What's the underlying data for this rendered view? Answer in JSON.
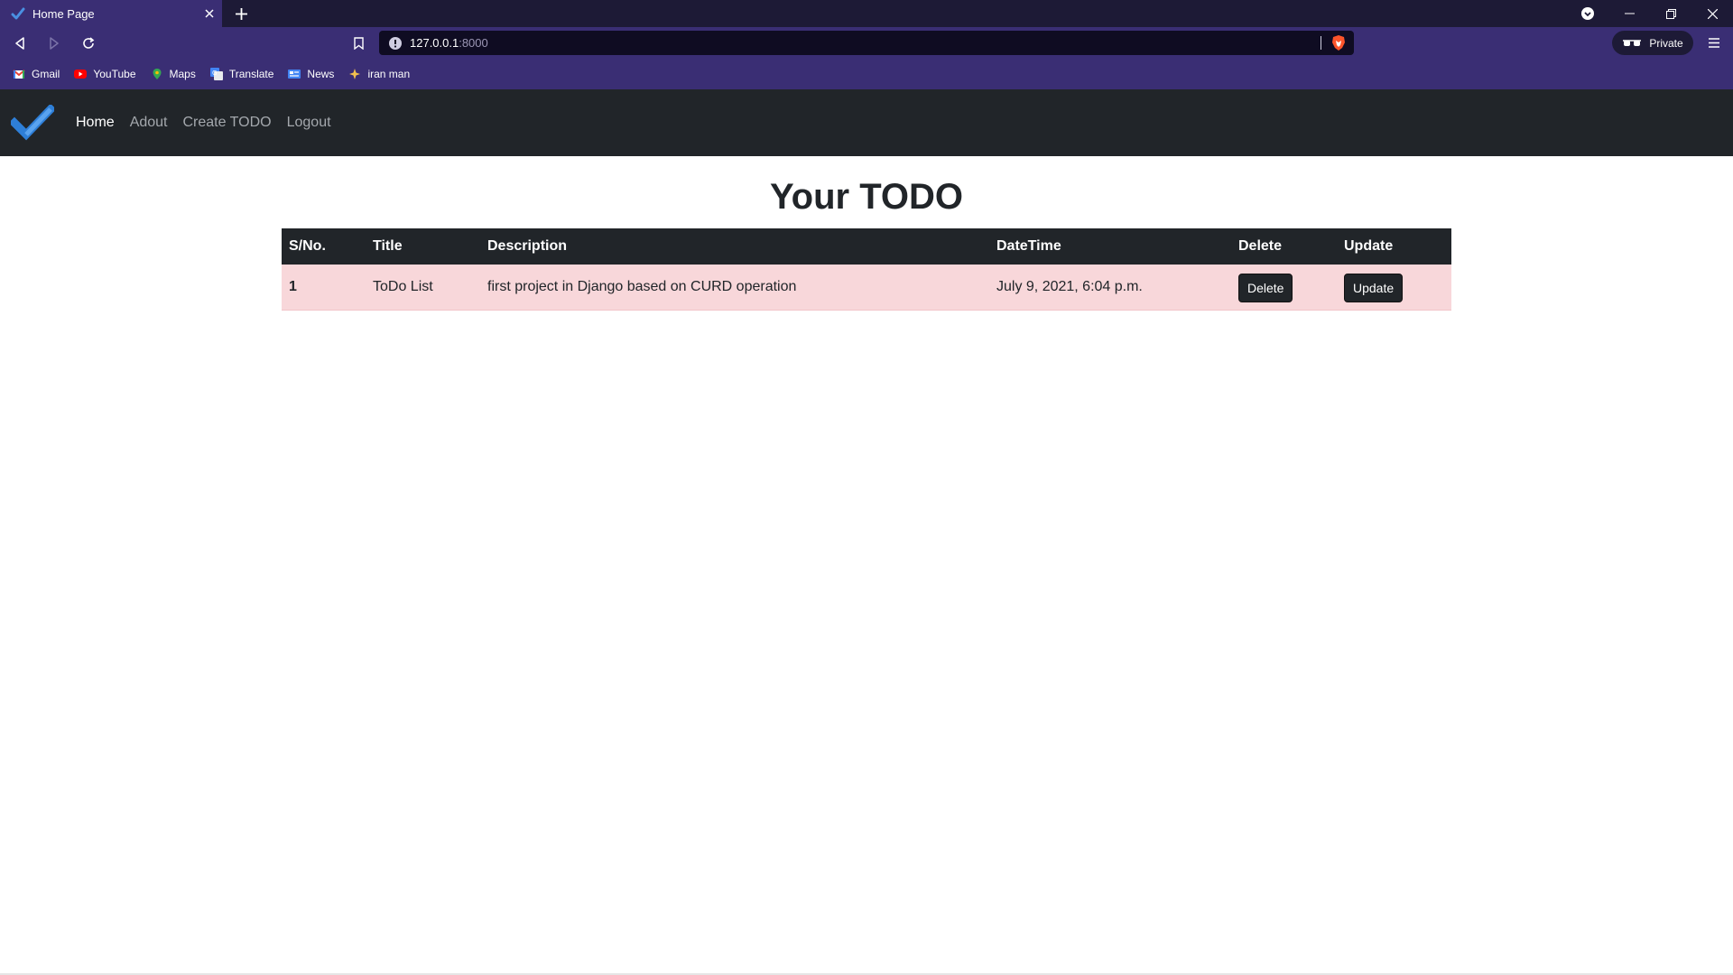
{
  "browser": {
    "tab_title": "Home Page",
    "url_host": "127.0.0.1",
    "url_port": ":8000",
    "private_label": "Private",
    "bookmarks": [
      {
        "label": "Gmail",
        "icon": "gmail-icon"
      },
      {
        "label": "YouTube",
        "icon": "youtube-icon"
      },
      {
        "label": "Maps",
        "icon": "maps-icon"
      },
      {
        "label": "Translate",
        "icon": "translate-icon"
      },
      {
        "label": "News",
        "icon": "news-icon"
      },
      {
        "label": "iran man",
        "icon": "bookmark-favicon-icon"
      }
    ]
  },
  "nav": {
    "links": [
      "Home",
      "Adout",
      "Create TODO",
      "Logout"
    ],
    "active": "Home"
  },
  "page": {
    "title": "Your TODO"
  },
  "table": {
    "headers": [
      "S/No.",
      "Title",
      "Description",
      "DateTime",
      "Delete",
      "Update"
    ],
    "rows": [
      {
        "sn": "1",
        "title": "ToDo List",
        "description": "first project in Django based on CURD operation",
        "datetime": "July 9, 2021, 6:04 p.m.",
        "delete_label": "Delete",
        "update_label": "Update"
      }
    ]
  },
  "colors": {
    "navbar_bg": "#212529",
    "row_bg": "#f8d7da",
    "header_bg": "#212529",
    "browser_chrome": "#3a2e74"
  }
}
